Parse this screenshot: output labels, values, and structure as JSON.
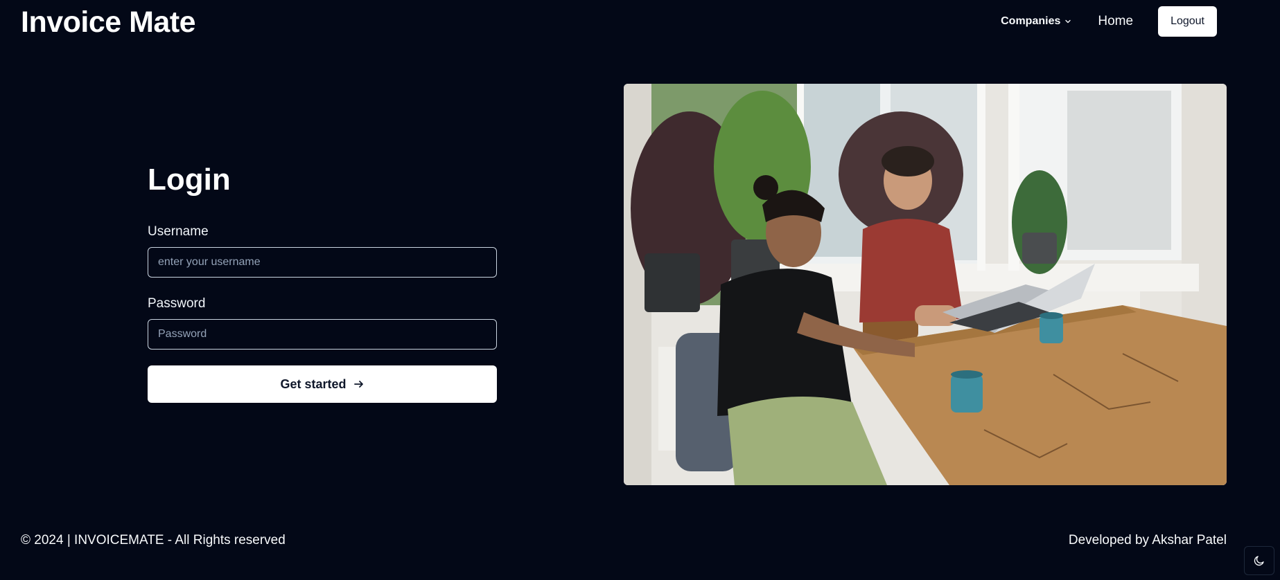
{
  "header": {
    "brand": "Invoice Mate",
    "nav": {
      "companies_label": "Companies",
      "home_label": "Home",
      "logout_label": "Logout"
    }
  },
  "login": {
    "title": "Login",
    "username": {
      "label": "Username",
      "placeholder": "enter your username",
      "value": ""
    },
    "password": {
      "label": "Password",
      "placeholder": "Password",
      "value": ""
    },
    "submit_label": "Get started"
  },
  "footer": {
    "copyright": "© 2024 | INVOICEMATE - All Rights reserved",
    "credit": "Developed by Akshar Patel"
  },
  "icons": {
    "companies_dropdown": "chevron-down-icon",
    "submit": "arrow-right-icon",
    "theme_toggle": "moon-icon"
  },
  "colors": {
    "background": "#030817",
    "text": "#f8fafc",
    "button_bg": "#ffffff",
    "button_text": "#0f172a",
    "input_border": "#cbd5e1"
  }
}
